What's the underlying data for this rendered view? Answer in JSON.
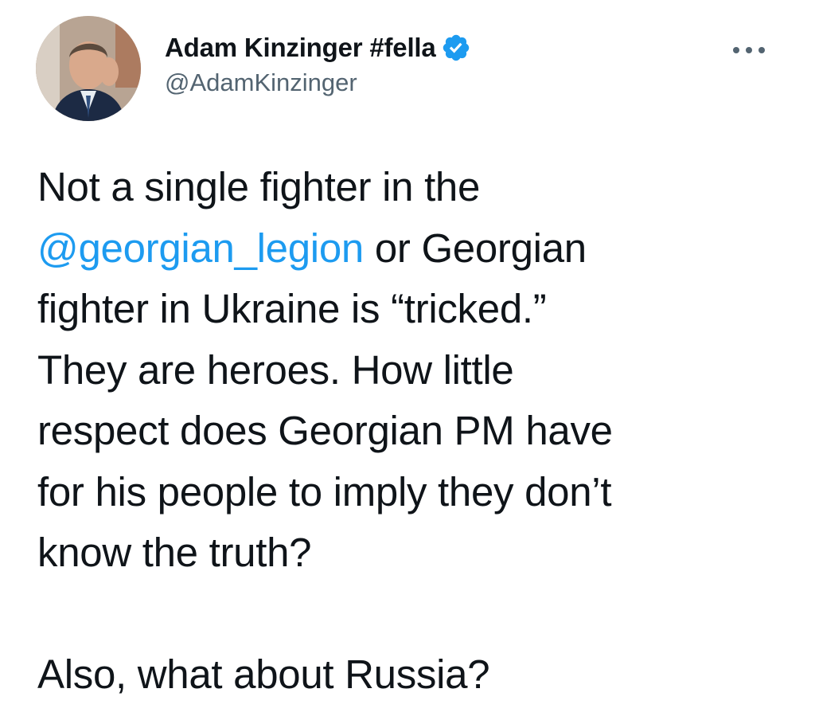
{
  "author": {
    "display_name": "Adam Kinzinger #fella",
    "handle": "@AdamKinzinger",
    "verified": true,
    "verified_color": "#1d9bf0",
    "avatar_icon": "profile-photo"
  },
  "menu": {
    "icon": "more-horizontal-icon"
  },
  "tweet": {
    "line1": "Not a single fighter in the",
    "mention": "@georgian_legion",
    "line2_rest": " or Georgian",
    "line3": "fighter in Ukraine is “tricked.”",
    "line4": "They are heroes.  How little",
    "line5": "respect does Georgian PM have",
    "line6": "for his people to imply they don’t",
    "line7": "know the truth?",
    "line8": "Also, what about Russia?"
  },
  "colors": {
    "text": "#0f1419",
    "secondary": "#536471",
    "link": "#1d9bf0"
  }
}
